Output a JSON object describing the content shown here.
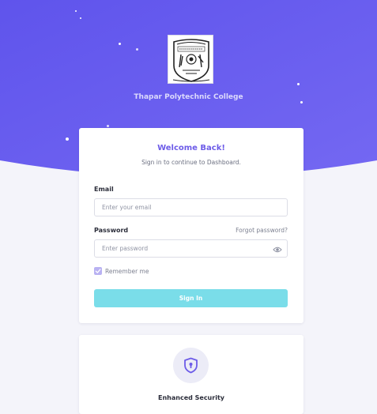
{
  "header": {
    "college_name": "Thapar Polytechnic College",
    "logo_icon": "college-crest-icon"
  },
  "login": {
    "title": "Welcome Back!",
    "subtitle": "Sign in to continue to Dashboard.",
    "email_label": "Email",
    "email_placeholder": "Enter your email",
    "email_value": "",
    "password_label": "Password",
    "forgot_label": "Forgot password?",
    "password_placeholder": "Enter password",
    "password_value": "",
    "remember_label": "Remember me",
    "remember_checked": true,
    "signin_label": "Sign In"
  },
  "security": {
    "title": "Enhanced Security",
    "icon": "shield-lock-icon"
  },
  "colors": {
    "hero_start": "#5f54ec",
    "hero_end": "#7468f2",
    "accent": "#6d5ce8",
    "button": "#7adde9",
    "page_bg": "#f4f4fa"
  }
}
